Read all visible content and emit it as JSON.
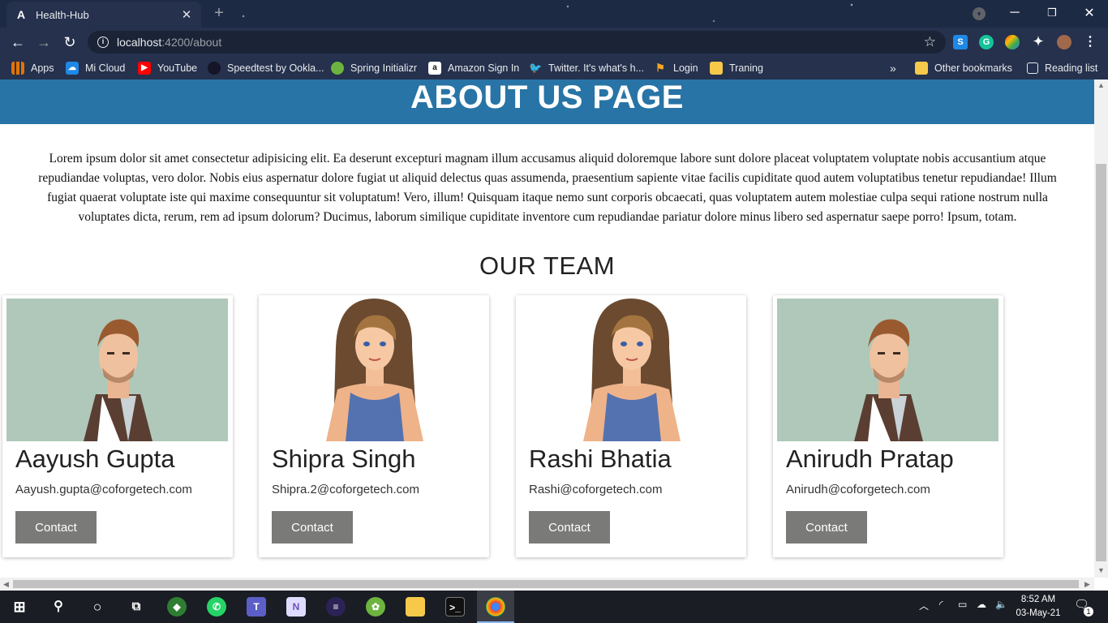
{
  "browser": {
    "tab_title": "Health-Hub",
    "tab_icon": "angular-logo-icon",
    "tab_close": "✕",
    "new_tab": "+",
    "url_host": "localhost",
    "url_path": ":4200/about",
    "bookmarks": [
      {
        "label": "Apps",
        "icon": "apps-grid-icon",
        "color": "#e37400"
      },
      {
        "label": "Mi Cloud",
        "icon": "mi-cloud-icon",
        "color": "#1e88e5"
      },
      {
        "label": "YouTube",
        "icon": "youtube-icon",
        "color": "#ff0000"
      },
      {
        "label": "Speedtest by Ookla...",
        "icon": "speedtest-icon",
        "color": "#141526"
      },
      {
        "label": "Spring Initializr",
        "icon": "spring-icon",
        "color": "#6db33f"
      },
      {
        "label": "Amazon Sign In",
        "icon": "amazon-icon",
        "color": "#ffffff"
      },
      {
        "label": "Twitter. It's what's h...",
        "icon": "twitter-icon",
        "color": "#1da1f2"
      },
      {
        "label": "Login",
        "icon": "login-icon",
        "color": "#f5a623"
      },
      {
        "label": "Traning",
        "icon": "folder-icon",
        "color": "#f6c94a"
      }
    ],
    "more_bookmarks": "»",
    "other_bookmarks": "Other bookmarks",
    "reading_list": "Reading list"
  },
  "page": {
    "title": "ABOUT US PAGE",
    "intro": "Lorem ipsum dolor sit amet consectetur adipisicing elit. Ea deserunt excepturi magnam illum accusamus aliquid doloremque labore sunt dolore placeat voluptatem voluptate nobis accusantium atque repudiandae voluptas, vero dolor. Nobis eius aspernatur dolore fugiat ut aliquid delectus quas assumenda, praesentium sapiente vitae facilis cupiditate quod autem voluptatibus tenetur repudiandae! Illum fugiat quaerat voluptate iste qui maxime consequuntur sit voluptatum! Vero, illum! Quisquam itaque nemo sunt corporis obcaecati, quas voluptatem autem molestiae culpa sequi ratione nostrum nulla voluptates dicta, rerum, rem ad ipsum dolorum? Ducimus, laborum similique cupiditate inventore cum repudiandae pariatur dolore minus libero sed aspernatur saepe porro! Ipsum, totam.",
    "team_heading": "OUR TEAM",
    "team": [
      {
        "name": "Aayush Gupta",
        "email": "Aayush.gupta@coforgetech.com",
        "button": "Contact",
        "avatar": "male-avatar"
      },
      {
        "name": "Shipra Singh",
        "email": "Shipra.2@coforgetech.com",
        "button": "Contact",
        "avatar": "female-avatar"
      },
      {
        "name": "Rashi Bhatia",
        "email": "Rashi@coforgetech.com",
        "button": "Contact",
        "avatar": "female-avatar"
      },
      {
        "name": "Anirudh Pratap",
        "email": "Anirudh@coforgetech.com",
        "button": "Contact",
        "avatar": "male-avatar"
      }
    ]
  },
  "taskbar": {
    "time": "8:52 AM",
    "date": "03-May-21",
    "notification_count": "1"
  },
  "colors": {
    "hero_bg": "#2874a6",
    "button_bg": "#7a7b78",
    "chrome_bg": "#25314d"
  }
}
